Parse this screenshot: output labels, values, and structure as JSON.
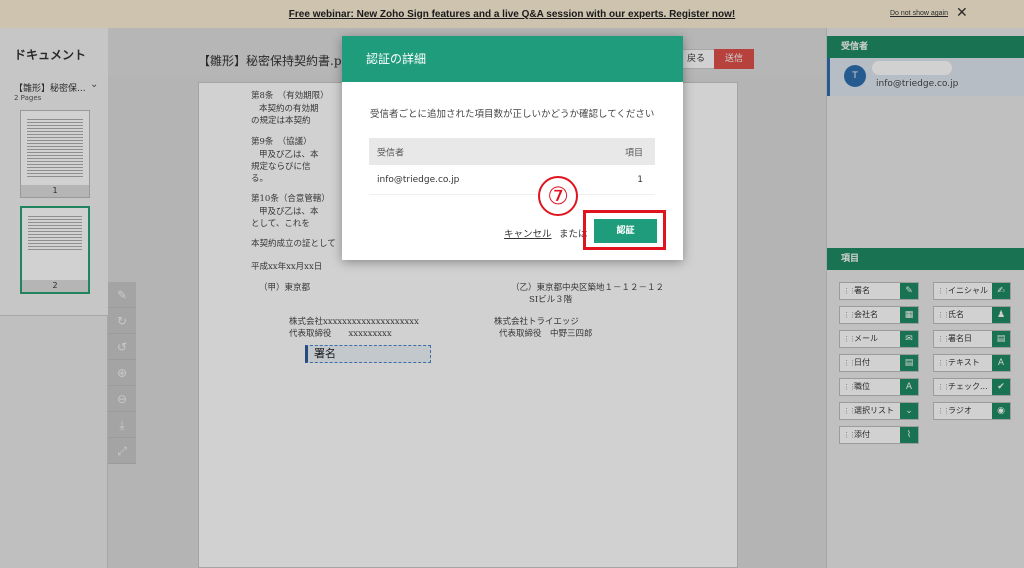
{
  "banner": {
    "text": "Free webinar: New Zoho Sign features and a live Q&A session with our experts. Register now!",
    "dismiss": "Do not show again",
    "close": "✕"
  },
  "left_panel": {
    "title": "ドキュメント",
    "doc_name": "【雛形】秘密保...",
    "pages_count": "2 Pages",
    "thumbnails": [
      "1",
      "2"
    ]
  },
  "header": {
    "doc_title": "【雛形】秘密保持契約書.p",
    "back_label": "戻る",
    "send_label": "送信"
  },
  "document": {
    "lines": [
      "第8条　（有効期限）",
      "本契約の有効期",
      "の規定は本契約",
      "第9条　（協議）",
      "甲及び乙は、本",
      "規定ならびに信",
      "る。",
      "第10条（合意管轄）",
      "甲及び乙は、本",
      "として、これを",
      "本契約成立の証として",
      "平成xx年xx月xx日",
      "（甲）東京都",
      "（乙）東京都中央区築地１－１２－１２",
      "SIビル３階",
      "株式会社xxxxxxxxxxxxxxxxxxxx",
      "代表取締役　　xxxxxxxxx",
      "株式会社トライエッジ",
      "代表取締役　中野三四郎"
    ],
    "signature_field": "署名"
  },
  "right_panel": {
    "recipients_title": "受信者",
    "recipient_initial": "T",
    "recipient_email": "info@triedge.co.jp",
    "fields_title": "項目",
    "fields": [
      {
        "label": "署名",
        "icon": "pen-icon",
        "glyph": "✎"
      },
      {
        "label": "イニシャル",
        "icon": "initial-pen-icon",
        "glyph": "✍"
      },
      {
        "label": "会社名",
        "icon": "building-icon",
        "glyph": "▦"
      },
      {
        "label": "氏名",
        "icon": "person-icon",
        "glyph": "♟"
      },
      {
        "label": "メール",
        "icon": "mail-icon",
        "glyph": "✉"
      },
      {
        "label": "署名日",
        "icon": "calendar-icon",
        "glyph": "▤"
      },
      {
        "label": "日付",
        "icon": "calendar-icon",
        "glyph": "▤"
      },
      {
        "label": "テキスト",
        "icon": "text-icon",
        "glyph": "A"
      },
      {
        "label": "職位",
        "icon": "text-icon",
        "glyph": "A"
      },
      {
        "label": "チェック...",
        "icon": "checkbox-icon",
        "glyph": "✔"
      },
      {
        "label": "選択リスト",
        "icon": "chevron-down-icon",
        "glyph": "⌄"
      },
      {
        "label": "ラジオ",
        "icon": "radio-icon",
        "glyph": "◉"
      },
      {
        "label": "添付",
        "icon": "paperclip-icon",
        "glyph": "⌇"
      }
    ]
  },
  "modal": {
    "title": "認証の詳細",
    "message": "受信者ごとに追加された項目数が正しいかどうか確認してください",
    "table": {
      "headers": [
        "受信者",
        "項目"
      ],
      "rows": [
        [
          "info@triedge.co.jp",
          "1"
        ]
      ]
    },
    "cancel_label": "キャンセル",
    "or_label": "または",
    "verify_label": "認証"
  },
  "annotation": {
    "step": "⑦",
    "color": "#e0141e"
  }
}
